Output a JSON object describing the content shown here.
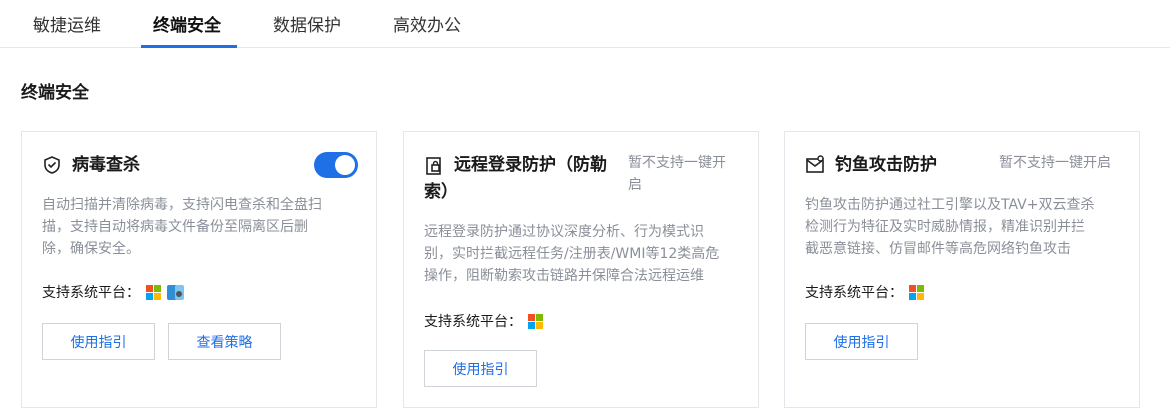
{
  "tabs": [
    {
      "label": "敏捷运维",
      "active": false
    },
    {
      "label": "终端安全",
      "active": true
    },
    {
      "label": "数据保护",
      "active": false
    },
    {
      "label": "高效办公",
      "active": false
    }
  ],
  "section": {
    "title": "终端安全"
  },
  "cards": [
    {
      "title": "病毒查杀",
      "icon": "shield-check-icon",
      "toggle_on": true,
      "desc_lines": [
        "自动扫描并清除病毒，支持闪电查杀和全盘扫",
        "描，支持自动将病毒文件备份至隔离区后删",
        "除，确保安全。"
      ],
      "platform_label": "支持系统平台：",
      "platforms": [
        "windows-icon",
        "macos-icon"
      ],
      "buttons": [
        "使用指引",
        "查看策略"
      ]
    },
    {
      "title_lines": [
        "远程登录防护（防勒",
        "索）"
      ],
      "icon": "remote-login-icon",
      "status_lines": [
        "暂不支持一键开",
        "启"
      ],
      "desc_lines": [
        "远程登录防护通过协议深度分析、行为模式识",
        "别，实时拦截远程任务/注册表/WMI等12类高危",
        "操作，阻断勒索攻击链路并保障合法远程运维"
      ],
      "platform_label": "支持系统平台：",
      "platforms": [
        "windows-icon"
      ],
      "buttons": [
        "使用指引"
      ]
    },
    {
      "title": "钓鱼攻击防护",
      "icon": "phishing-mail-icon",
      "status": "暂不支持一键开启",
      "desc_lines": [
        "钓鱼攻击防护通过社工引擎以及TAV+双云查杀",
        "检测行为特征及实时威胁情报，精准识别并拦",
        "截恶意链接、仿冒邮件等高危网络钓鱼攻击"
      ],
      "platform_label": "支持系统平台：",
      "platforms": [
        "windows-icon"
      ],
      "buttons": [
        "使用指引"
      ]
    }
  ],
  "colors": {
    "accent": "#1f6fe6",
    "muted_text": "#8a8f99",
    "border": "#e3e6ea"
  }
}
